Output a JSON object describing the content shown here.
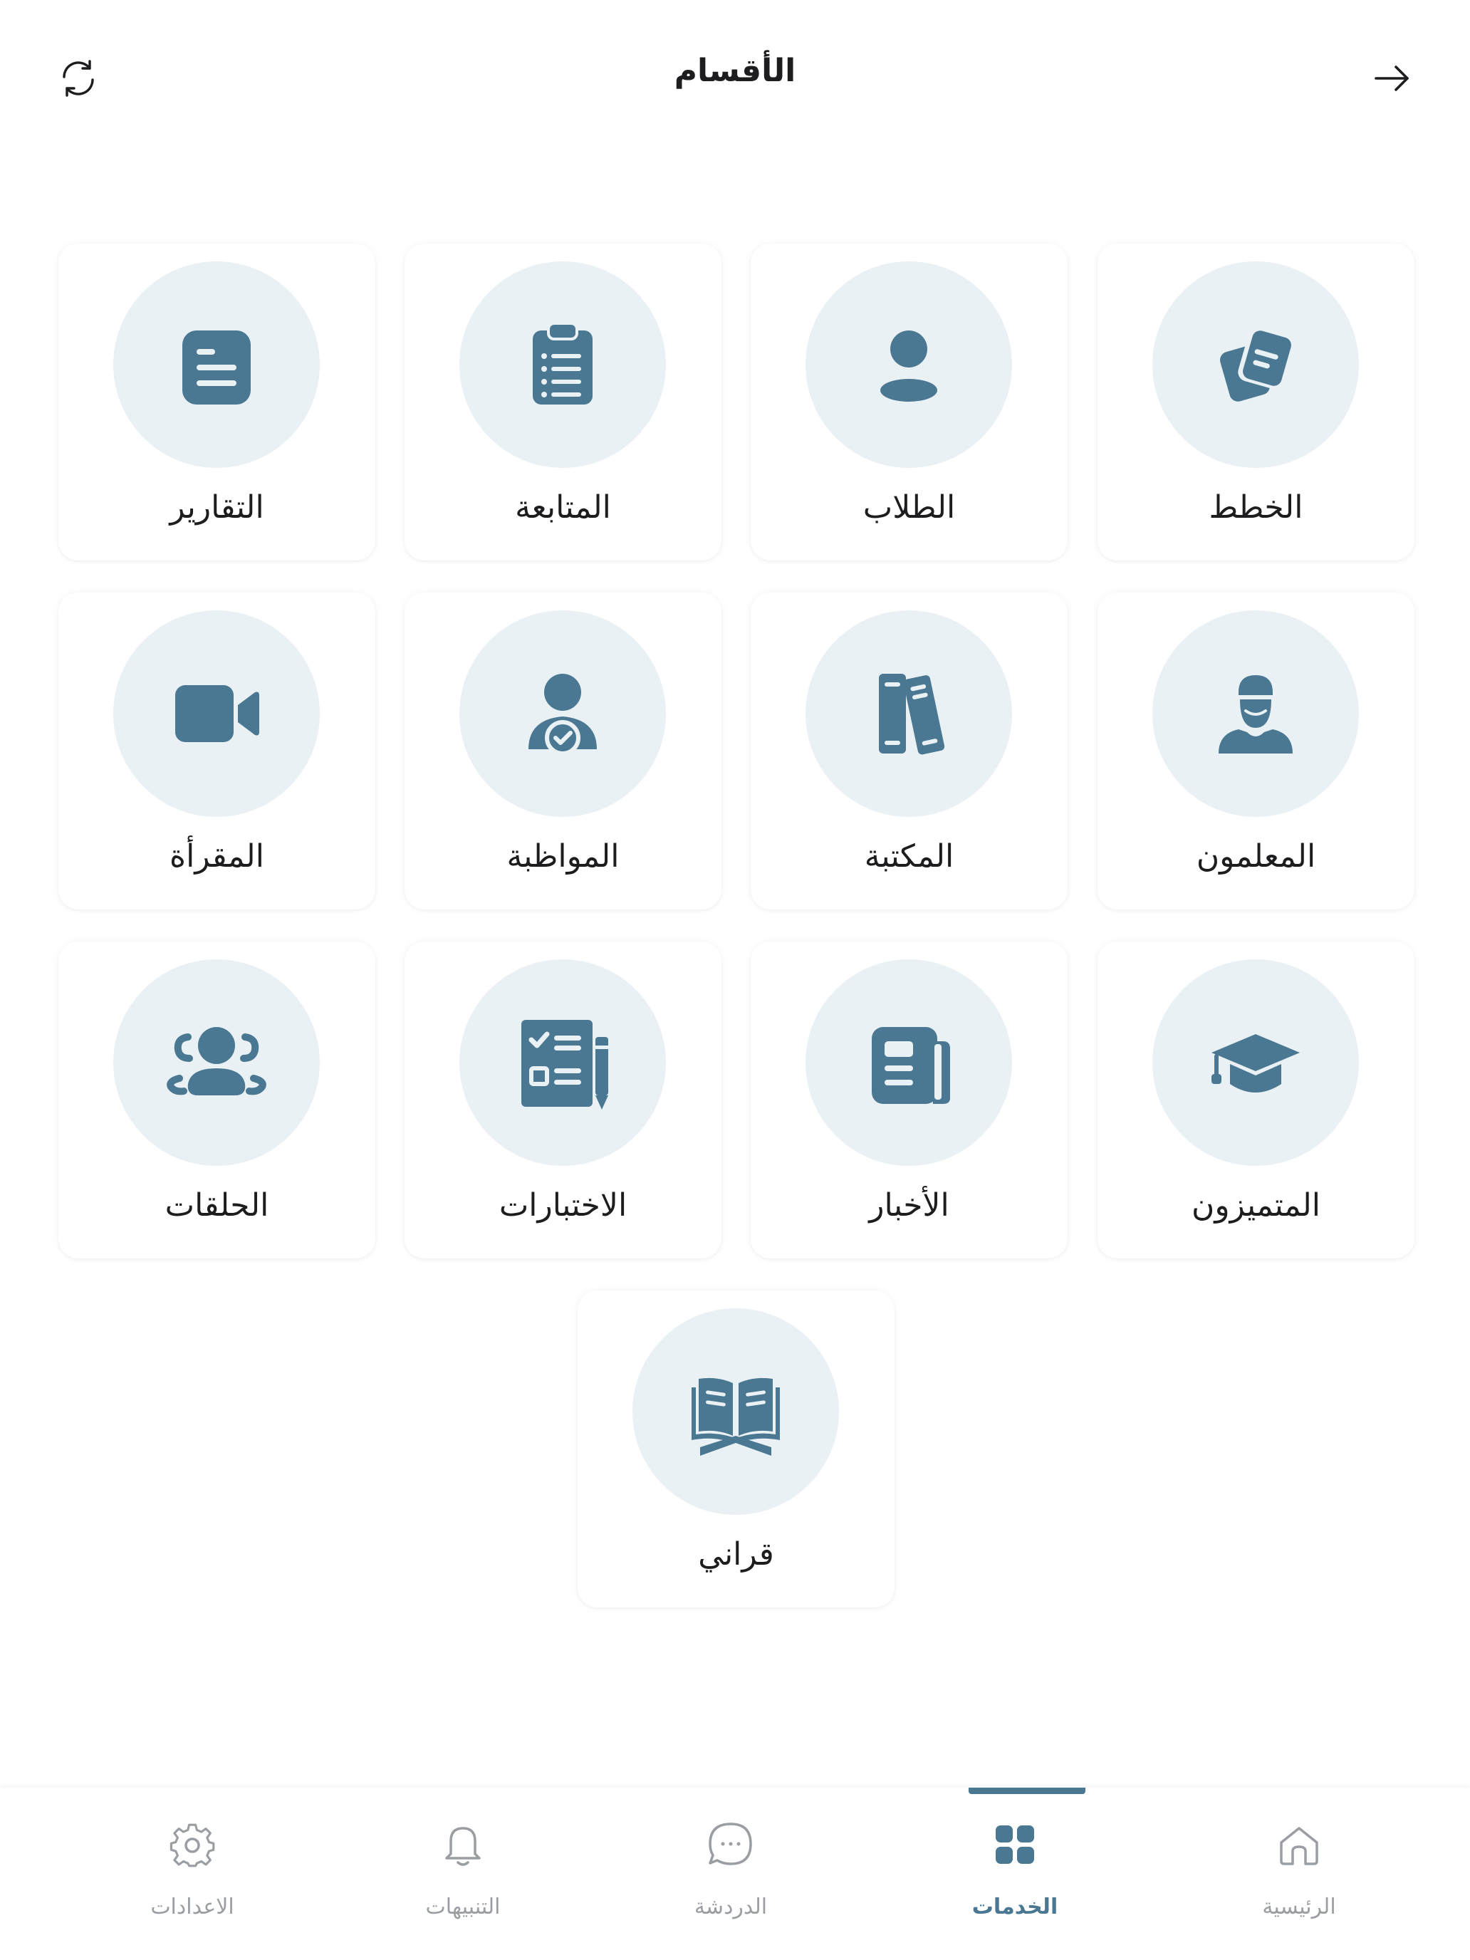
{
  "header": {
    "title": "الأقسام",
    "back_icon": "arrow-right-icon",
    "refresh_icon": "refresh-icon"
  },
  "colors": {
    "accent": "#4a7892",
    "icon_circle": "#eaf1f4",
    "inactive_nav": "#9a9ea3"
  },
  "sections": [
    {
      "label": "الخطط",
      "icon": "plans-icon"
    },
    {
      "label": "الطلاب",
      "icon": "students-icon"
    },
    {
      "label": "المتابعة",
      "icon": "clipboard-icon"
    },
    {
      "label": "التقارير",
      "icon": "reports-icon"
    },
    {
      "label": "المعلمون",
      "icon": "teacher-icon"
    },
    {
      "label": "المكتبة",
      "icon": "books-icon"
    },
    {
      "label": "المواظبة",
      "icon": "attendance-icon"
    },
    {
      "label": "المقرأة",
      "icon": "video-icon"
    },
    {
      "label": "المتميزون",
      "icon": "graduation-cap-icon"
    },
    {
      "label": "الأخبار",
      "icon": "newspaper-icon"
    },
    {
      "label": "الاختبارات",
      "icon": "exam-icon"
    },
    {
      "label": "الحلقات",
      "icon": "group-icon"
    },
    {
      "label": "قراني",
      "icon": "quran-icon"
    }
  ],
  "bottom_nav": {
    "active": "services",
    "items": [
      {
        "label": "الرئيسية",
        "icon": "home-icon"
      },
      {
        "label": "الخدمات",
        "icon": "grid-icon"
      },
      {
        "label": "الدردشة",
        "icon": "chat-icon"
      },
      {
        "label": "التنبيهات",
        "icon": "bell-icon"
      },
      {
        "label": "الاعدادات",
        "icon": "settings-icon"
      }
    ]
  }
}
